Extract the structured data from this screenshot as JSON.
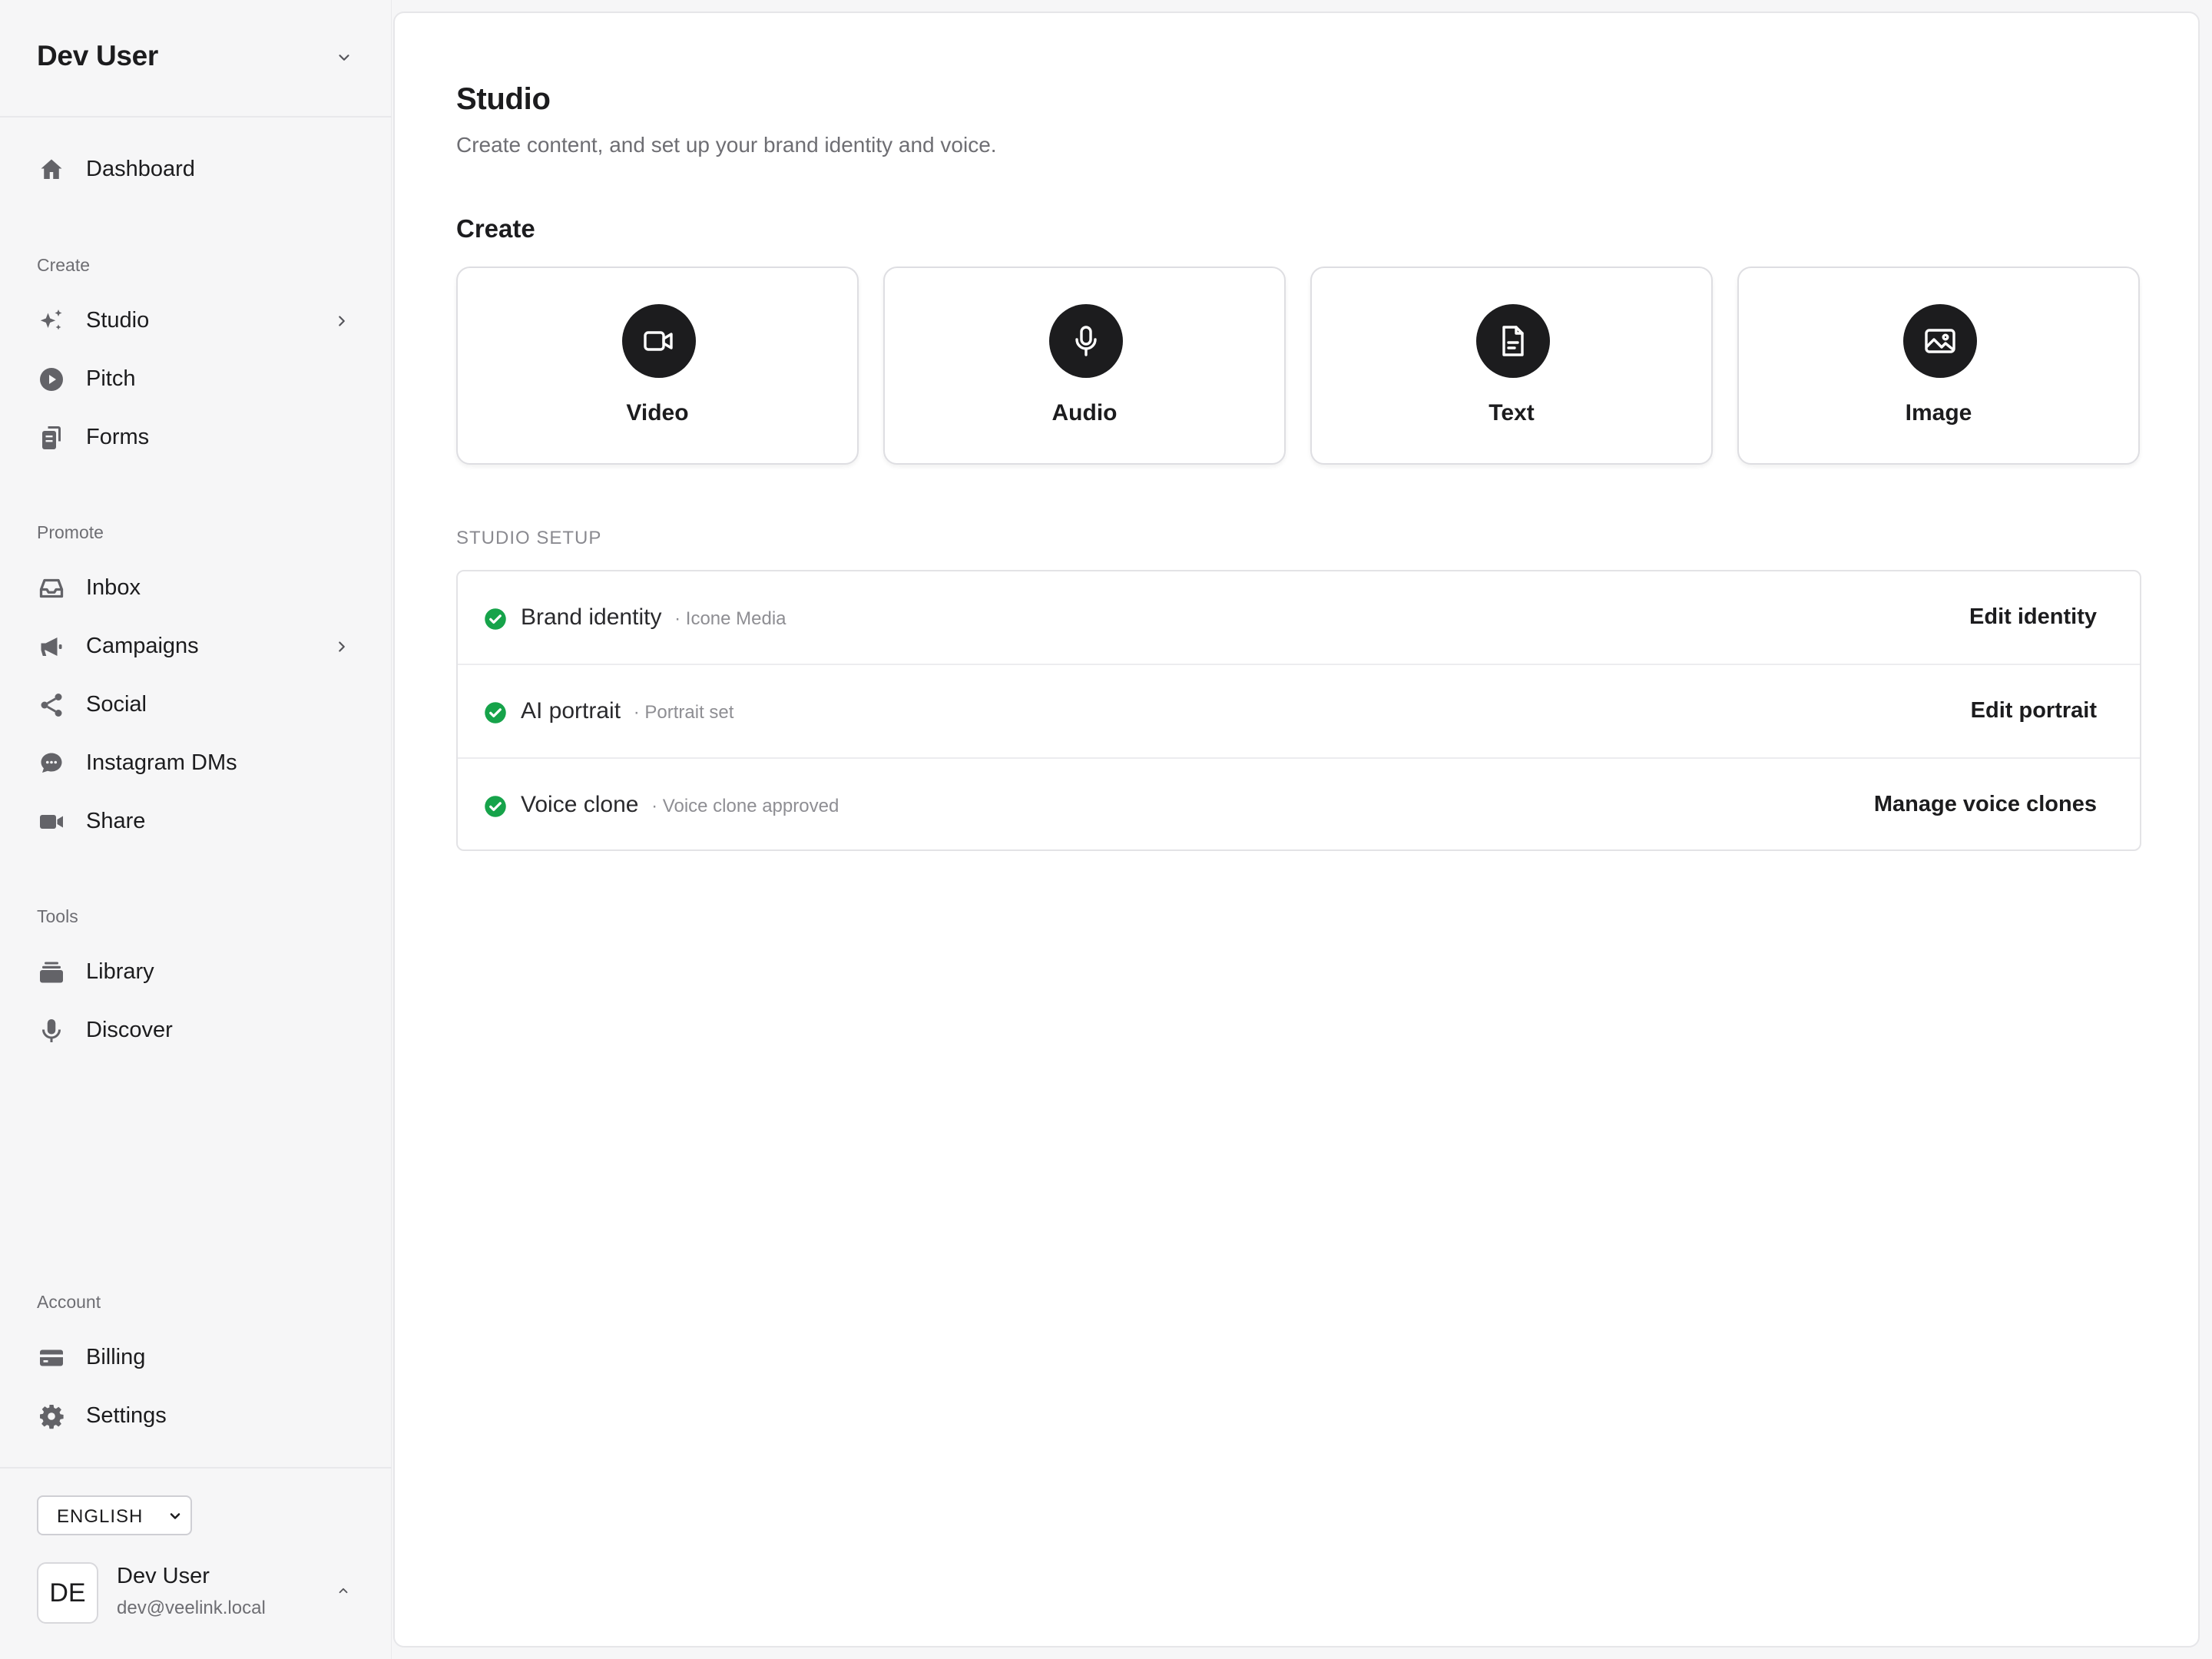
{
  "workspace": {
    "name": "Dev User"
  },
  "sidebar": {
    "dashboard": {
      "label": "Dashboard",
      "icon": "home-icon"
    },
    "sections": [
      {
        "title": "Create",
        "items": [
          {
            "label": "Studio",
            "icon": "sparkles-icon",
            "has_submenu": true
          },
          {
            "label": "Pitch",
            "icon": "play-circle-icon"
          },
          {
            "label": "Forms",
            "icon": "forms-icon"
          }
        ]
      },
      {
        "title": "Promote",
        "items": [
          {
            "label": "Inbox",
            "icon": "inbox-icon"
          },
          {
            "label": "Campaigns",
            "icon": "megaphone-icon",
            "has_submenu": true
          },
          {
            "label": "Social",
            "icon": "share-nodes-icon"
          },
          {
            "label": "Instagram DMs",
            "icon": "chat-bubble-icon"
          },
          {
            "label": "Share",
            "icon": "video-camera-icon"
          }
        ]
      },
      {
        "title": "Tools",
        "items": [
          {
            "label": "Library",
            "icon": "library-icon"
          },
          {
            "label": "Discover",
            "icon": "microphone-icon"
          }
        ]
      },
      {
        "title": "Account",
        "items": [
          {
            "label": "Billing",
            "icon": "credit-card-icon"
          },
          {
            "label": "Settings",
            "icon": "gear-icon"
          }
        ]
      }
    ]
  },
  "footer": {
    "language": "ENGLISH",
    "user": {
      "initials": "DE",
      "name": "Dev User",
      "email": "dev@veelink.local"
    }
  },
  "main": {
    "title": "Studio",
    "subtitle": "Create content, and set up your brand identity and voice.",
    "create_heading": "Create",
    "create_cards": [
      {
        "label": "Video",
        "icon": "video-camera-icon"
      },
      {
        "label": "Audio",
        "icon": "microphone-icon"
      },
      {
        "label": "Text",
        "icon": "document-icon"
      },
      {
        "label": "Image",
        "icon": "image-icon"
      }
    ],
    "setup_heading": "STUDIO SETUP",
    "setup_rows": [
      {
        "title": "Brand identity",
        "meta": "· Icone Media",
        "action": "Edit identity",
        "status": "complete"
      },
      {
        "title": "AI portrait",
        "meta": "· Portrait set",
        "action": "Edit portrait",
        "status": "complete"
      },
      {
        "title": "Voice clone",
        "meta": "· Voice clone approved",
        "action": "Manage voice clones",
        "status": "complete"
      }
    ]
  },
  "colors": {
    "accent_dark": "#1c1c1e",
    "success": "#16a34a",
    "muted_text": "#6e6e73",
    "sidebar_bg": "#f6f6f7"
  }
}
